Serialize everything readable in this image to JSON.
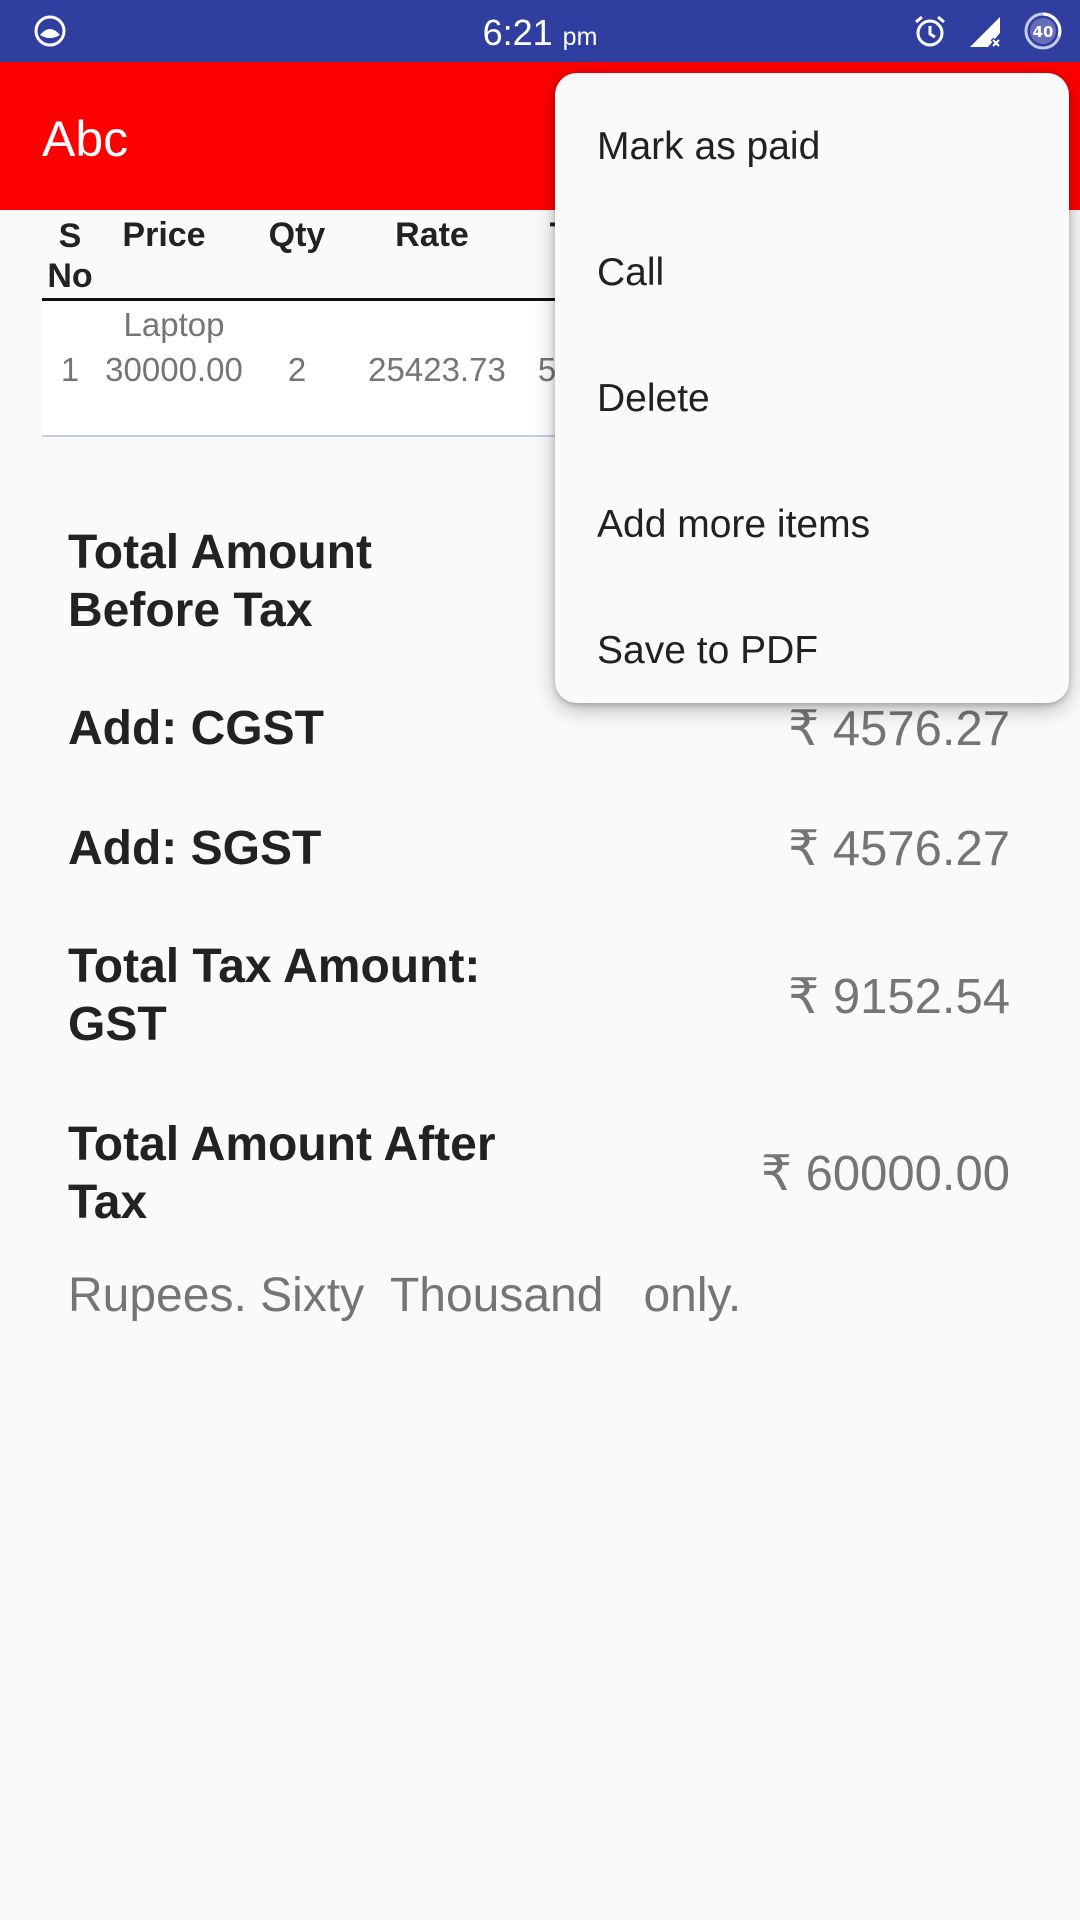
{
  "status_bar": {
    "time": "6:21",
    "ampm": "pm",
    "battery_level": "40",
    "icons": [
      "app-notification-icon",
      "alarm-icon",
      "signal-no-data-icon",
      "battery-icon"
    ]
  },
  "app_bar": {
    "title": "Abc",
    "background_color": "#ff0000"
  },
  "table": {
    "headers": {
      "sno_line1": "S",
      "sno_line2": "No",
      "price": "Price",
      "qty": "Qty",
      "rate": "Rate",
      "partial_next": "T"
    },
    "rows": [
      {
        "sno": "1",
        "item_name": "Laptop",
        "price": "30000.00",
        "qty": "2",
        "rate": "25423.73",
        "partial_next": "5"
      }
    ]
  },
  "summary": {
    "before_tax_label": "Total Amount Before Tax",
    "cgst_label": "Add: CGST",
    "cgst_value": "₹ 4576.27",
    "sgst_label": "Add: SGST",
    "sgst_value": "₹ 4576.27",
    "total_tax_label": "Total Tax Amount: GST",
    "total_tax_value": "₹ 9152.54",
    "after_tax_label": "Total Amount After Tax",
    "after_tax_value": "₹ 60000.00",
    "amount_in_words": "Rupees. Sixty  Thousand   only."
  },
  "menu": {
    "items": [
      "Mark as paid",
      "Call",
      "Delete",
      "Add more items",
      "Save to PDF"
    ]
  },
  "colors": {
    "status_bar": "#303f9f",
    "accent": "#ff0000"
  }
}
